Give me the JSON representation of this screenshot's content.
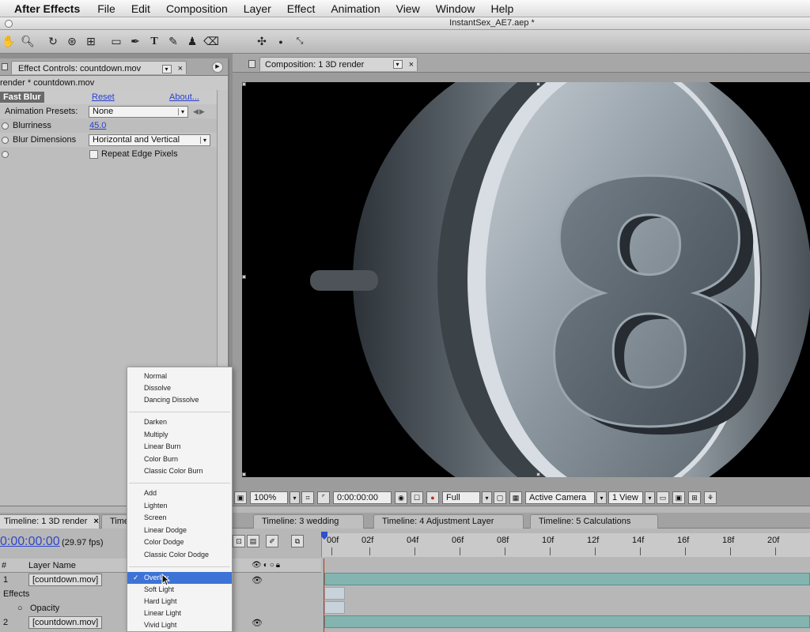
{
  "menubar": {
    "app_name": "After Effects",
    "items": [
      "File",
      "Edit",
      "Composition",
      "Layer",
      "Effect",
      "Animation",
      "View",
      "Window",
      "Help"
    ]
  },
  "window": {
    "title": "InstantSex_AE7.aep *"
  },
  "toolbar": {
    "tools": [
      "hand-icon",
      "zoom-icon",
      "rotate-icon",
      "orbit-camera-icon",
      "track-xy-icon",
      "rectangle-mask-icon",
      "pen-icon",
      "type-icon",
      "brush-icon",
      "clone-stamp-icon",
      "eraser-icon"
    ],
    "axis_tools": [
      "local-axis-icon",
      "world-axis-icon",
      "view-axis-icon"
    ]
  },
  "effect_controls": {
    "tab_label": "Effect Controls: countdown.mov",
    "subheader": "render * countdown.mov",
    "effect": {
      "name": "Fast Blur",
      "reset": "Reset",
      "about": "About...",
      "presets_label": "Animation Presets:",
      "presets_value": "None",
      "blurriness_label": "Blurriness",
      "blurriness_value": "45.0",
      "dimensions_label": "Blur Dimensions",
      "dimensions_value": "Horizontal and Vertical",
      "repeat_label": "Repeat Edge Pixels"
    }
  },
  "composition": {
    "tab_label": "Composition: 1 3D render",
    "countdown_digit": "8",
    "controls": {
      "zoom": "100%",
      "timecode": "0:00:00:00",
      "resolution": "Full",
      "camera": "Active Camera",
      "views": "1 View"
    }
  },
  "timeline": {
    "tabs": [
      {
        "label": "Timeline: 1 3D render",
        "active": true,
        "close": "×"
      },
      {
        "label": "Timeline: 2",
        "active": false
      },
      {
        "label": "Timeline: 3 wedding",
        "active": false
      },
      {
        "label": "Timeline: 4 Adjustment Layer",
        "active": false
      },
      {
        "label": "Timeline: 5 Calculations",
        "active": false
      }
    ],
    "timecode": "0:00:00:00",
    "fps": "(29.97 fps)",
    "ruler": [
      "00f",
      "02f",
      "04f",
      "06f",
      "08f",
      "10f",
      "12f",
      "14f",
      "16f",
      "18f",
      "20f"
    ],
    "header": {
      "num": "#",
      "name": "Layer Name"
    },
    "rows": [
      {
        "num": "1",
        "name": "[countdown.mov]"
      },
      {
        "label": "Effects"
      },
      {
        "label": "Opacity"
      },
      {
        "num": "2",
        "name": "[countdown.mov]"
      }
    ]
  },
  "blend_menu": {
    "groups": [
      [
        "Normal",
        "Dissolve",
        "Dancing Dissolve"
      ],
      [
        "Darken",
        "Multiply",
        "Linear Burn",
        "Color Burn",
        "Classic Color Burn"
      ],
      [
        "Add",
        "Lighten",
        "Screen",
        "Linear Dodge",
        "Color Dodge",
        "Classic Color Dodge"
      ],
      [
        "Overlay",
        "Soft Light",
        "Hard Light",
        "Linear Light",
        "Vivid Light"
      ]
    ],
    "selected": "Overlay",
    "check": "✓"
  },
  "colors": {
    "link_blue": "#2a3fd0",
    "selection_blue": "#3d73d6",
    "track_teal": "#84b4b0",
    "playhead_red": "#c03020"
  }
}
